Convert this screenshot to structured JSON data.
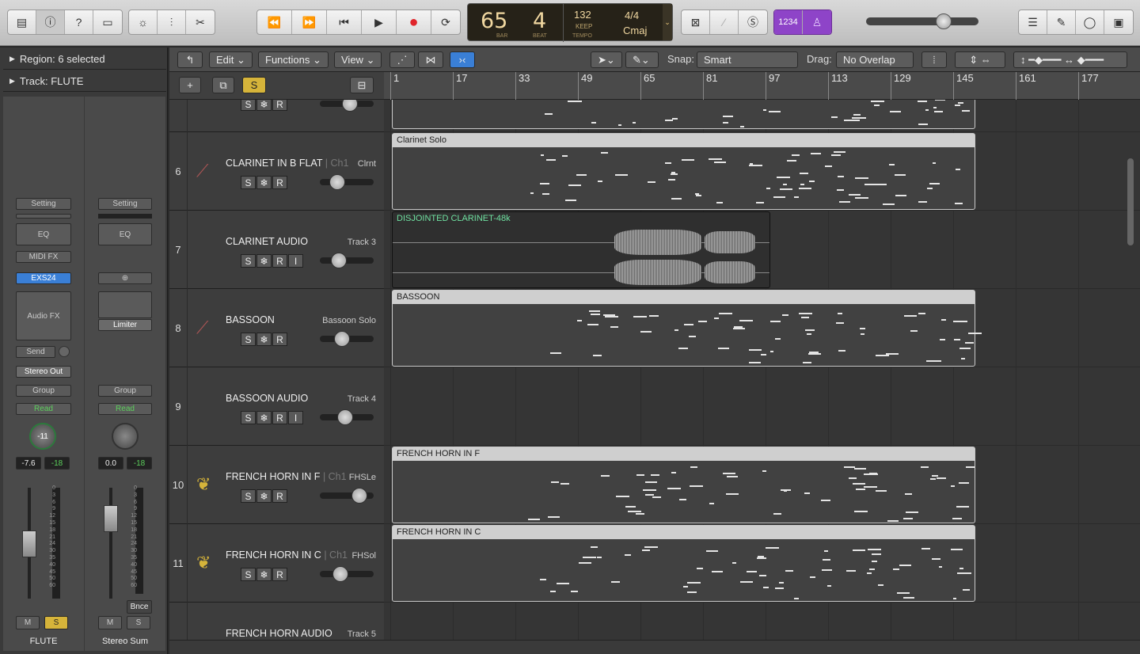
{
  "control_bar": {
    "transport": {
      "rewind": "⏪",
      "forward": "⏩",
      "start": "⏮",
      "play": "▶",
      "record": "●",
      "cycle": "⟳"
    },
    "lcd": {
      "bar": "65",
      "beat": "4",
      "bar_label": "BAR",
      "beat_label": "BEAT",
      "tempo": "132",
      "keep": "KEEP",
      "tempo_label": "TEMPO",
      "signature": "4/4",
      "key": "Cmaj"
    },
    "count_in": "1234",
    "left_icons": [
      "library-icon",
      "info-icon",
      "help-icon",
      "inspector-icon",
      "smart-controls-icon",
      "mixer-icon",
      "scissors-icon"
    ],
    "right_icons": [
      "list-editor-icon",
      "note-pad-icon",
      "loop-browser-icon",
      "media-browser-icon"
    ]
  },
  "inspector": {
    "region_label": "Region:",
    "region_value": "6 selected",
    "track_label": "Track:",
    "track_value": "FLUTE",
    "strips": [
      {
        "setting": "Setting",
        "eq": "EQ",
        "midi_fx": "MIDI FX",
        "instrument": "EXS24",
        "audio_fx": "Audio FX",
        "send": "Send",
        "output": "Stereo Out",
        "group": "Group",
        "automation": "Read",
        "pan": "-11",
        "volume": "-7.6",
        "peak": "-18",
        "mute": "M",
        "solo": "S",
        "name": "FLUTE"
      },
      {
        "setting": "Setting",
        "eq": "EQ",
        "instrument": "⊕",
        "limiter": "Limiter",
        "group": "Group",
        "automation": "Read",
        "volume": "0.0",
        "peak": "-18",
        "mute": "M",
        "solo": "S",
        "bounce": "Bnce",
        "name": "Stereo Sum"
      }
    ],
    "fader_scale": [
      "0",
      "3",
      "6",
      "9",
      "12",
      "15",
      "18",
      "21",
      "24",
      "30",
      "35",
      "40",
      "45",
      "50",
      "60"
    ]
  },
  "toolbar": {
    "edit": "Edit",
    "functions": "Functions",
    "view": "View",
    "snap_label": "Snap:",
    "snap_value": "Smart",
    "drag_label": "Drag:",
    "drag_value": "No Overlap"
  },
  "ruler": [
    "1",
    "17",
    "33",
    "49",
    "65",
    "81",
    "97",
    "113",
    "129",
    "145",
    "161",
    "177"
  ],
  "tracks": [
    {
      "num": "",
      "name": "",
      "ch": "",
      "right": "",
      "buttons": [
        "S",
        "❄",
        "R"
      ]
    },
    {
      "num": "6",
      "name": "CLARINET IN B FLAT",
      "ch": "| Ch1",
      "right": "Clrnt",
      "buttons": [
        "S",
        "❄",
        "R"
      ]
    },
    {
      "num": "7",
      "name": "CLARINET AUDIO",
      "ch": "",
      "right": "Track 3",
      "buttons": [
        "S",
        "❄",
        "R",
        "I"
      ]
    },
    {
      "num": "8",
      "name": "BASSOON",
      "ch": "",
      "right": "Bassoon Solo",
      "buttons": [
        "S",
        "❄",
        "R"
      ]
    },
    {
      "num": "9",
      "name": "BASSOON AUDIO",
      "ch": "",
      "right": "Track 4",
      "buttons": [
        "S",
        "❄",
        "R",
        "I"
      ]
    },
    {
      "num": "10",
      "name": "FRENCH HORN IN F",
      "ch": "| Ch1",
      "right": "FHSLe",
      "buttons": [
        "S",
        "❄",
        "R"
      ]
    },
    {
      "num": "11",
      "name": "FRENCH HORN IN C",
      "ch": "| Ch1",
      "right": "FHSol",
      "buttons": [
        "S",
        "❄",
        "R"
      ]
    },
    {
      "num": "",
      "name": "FRENCH HORN AUDIO",
      "ch": "",
      "right": "Track 5",
      "buttons": []
    }
  ],
  "regions": [
    {
      "title": "",
      "type": "midi"
    },
    {
      "title": "Clarinet Solo",
      "type": "midi"
    },
    {
      "title": "DISJOINTED CLARINET-48k",
      "type": "audio"
    },
    {
      "title": "BASSOON",
      "type": "midi"
    },
    {
      "title": "FRENCH HORN IN F",
      "type": "midi"
    },
    {
      "title": "FRENCH HORN IN C",
      "type": "midi"
    }
  ],
  "colors": {
    "accent_blue": "#3a7fd6",
    "solo_yellow": "#d6b43a",
    "record_red": "#e0252b",
    "read_green": "#5cd05c",
    "count_in_purple": "#8e44c8"
  }
}
